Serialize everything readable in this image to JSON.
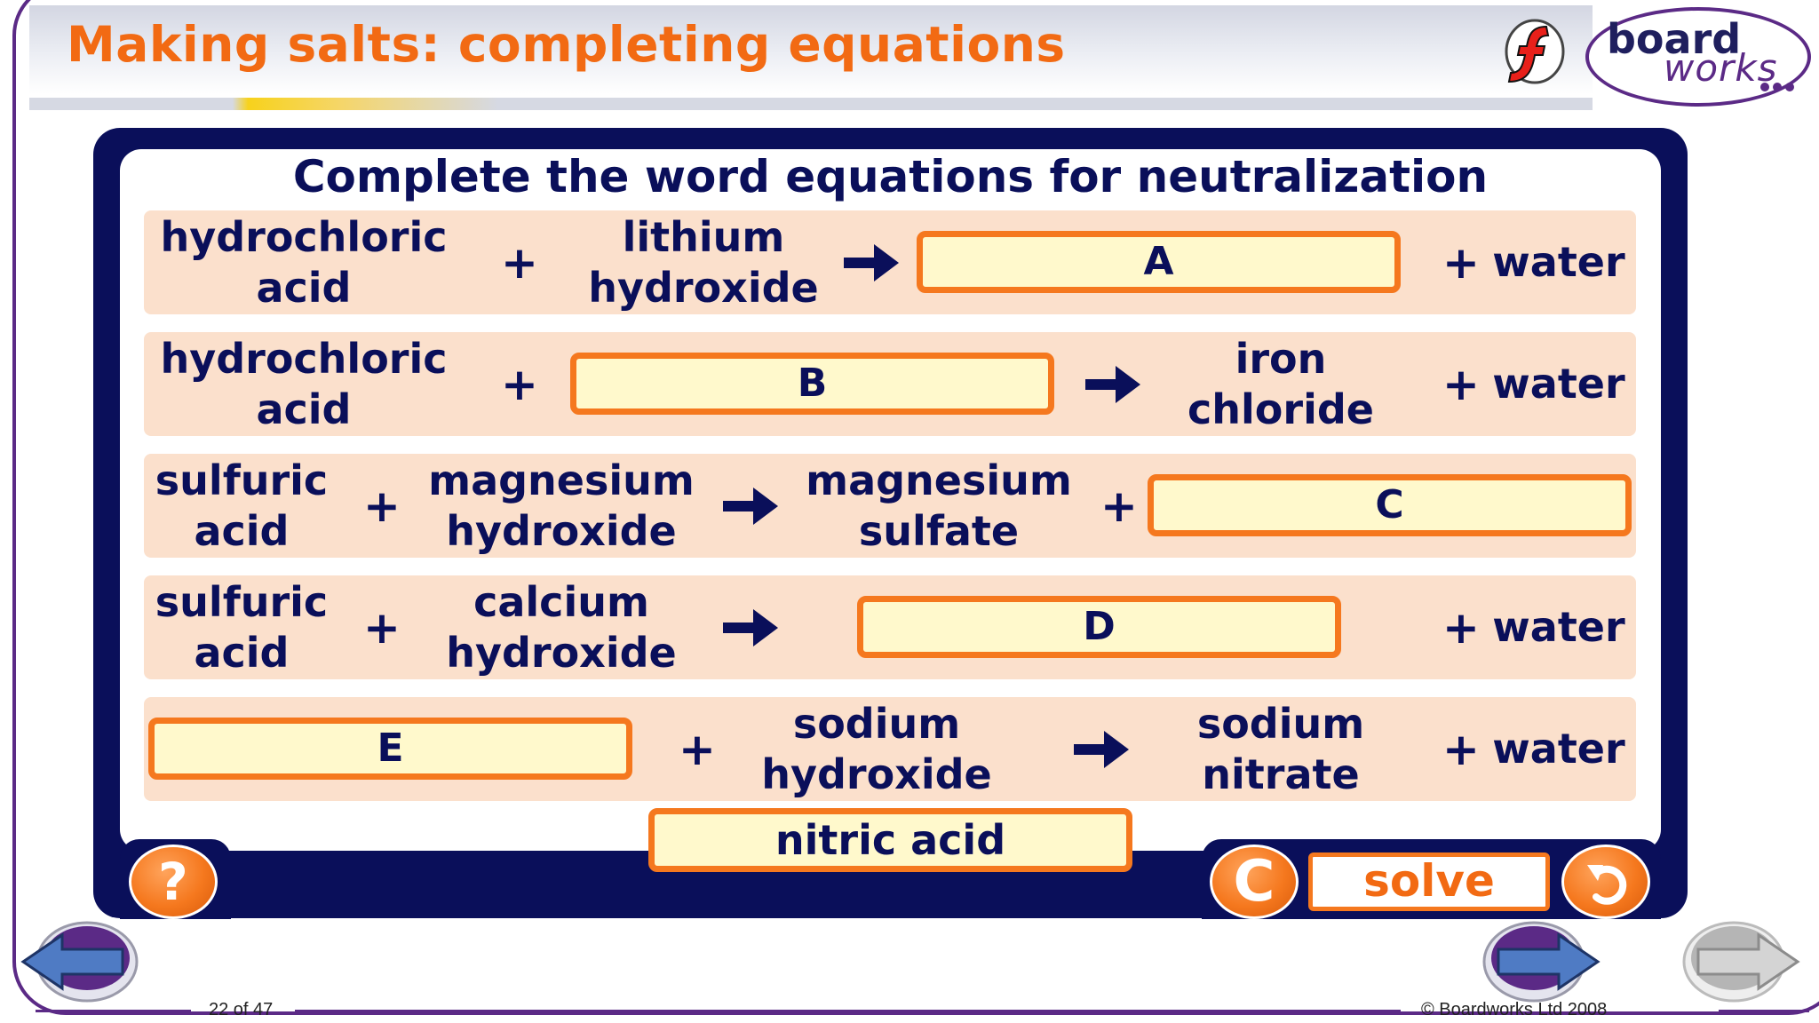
{
  "slide": {
    "title": "Making salts: completing equations",
    "page_counter": "22 of 47",
    "copyright": "© Boardworks Ltd 2008"
  },
  "logo": {
    "board": "board",
    "works": "works",
    "flash_icon": "flash-f-icon"
  },
  "activity": {
    "heading": "Complete the word equations for neutralization",
    "plus": "+",
    "row1": {
      "reactant1": [
        "hydrochloric",
        "acid"
      ],
      "reactant2": [
        "lithium",
        "hydroxide"
      ],
      "blank": "A",
      "product2": "water"
    },
    "row2": {
      "reactant1": [
        "hydrochloric",
        "acid"
      ],
      "blank": "B",
      "product1": [
        "iron",
        "chloride"
      ],
      "product2": "water"
    },
    "row3": {
      "reactant1": [
        "sulfuric",
        "acid"
      ],
      "reactant2": [
        "magnesium",
        "hydroxide"
      ],
      "product1": [
        "magnesium",
        "sulfate"
      ],
      "blank": "C"
    },
    "row4": {
      "reactant1": [
        "sulfuric",
        "acid"
      ],
      "reactant2": [
        "calcium",
        "hydroxide"
      ],
      "blank": "D",
      "product2": "water"
    },
    "row5": {
      "blank": "E",
      "reactant2": [
        "sodium",
        "hydroxide"
      ],
      "product1": [
        "sodium",
        "nitrate"
      ],
      "product2": "water"
    },
    "answer_tile": "nitric acid"
  },
  "controls": {
    "help_label": "?",
    "reset_label": "C",
    "solve_label": "solve",
    "undo_icon": "undo-arrow-icon"
  },
  "navigation": {
    "previous_icon": "back-arrow-icon",
    "next_icon": "forward-arrow-icon",
    "last_icon": "forward-arrow-disabled-icon"
  },
  "colors": {
    "title": "#f26a13",
    "navy": "#0a0f5a",
    "row_background": "#fbe0cc",
    "box_fill": "#fff9cc",
    "box_border": "#f5781e",
    "frame": "#5b2a86"
  }
}
